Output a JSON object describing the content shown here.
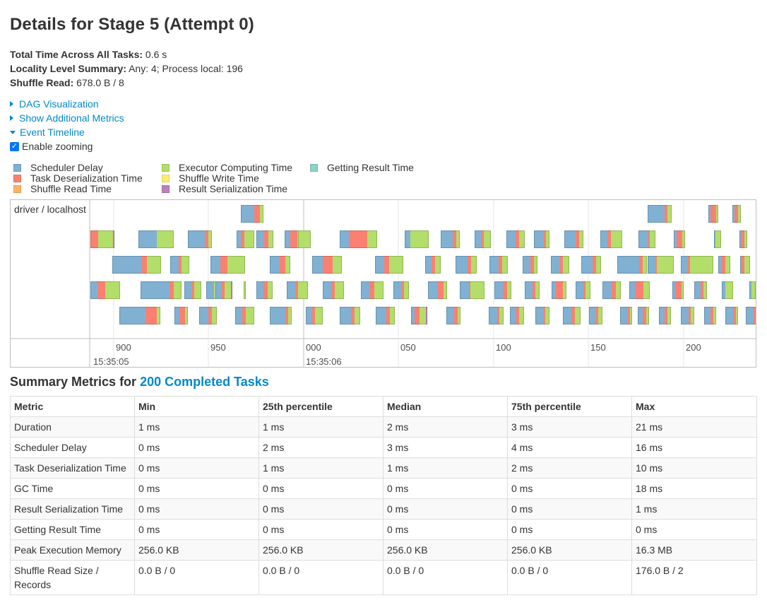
{
  "page": {
    "title": "Details for Stage 5 (Attempt 0)"
  },
  "summary": {
    "total_time_label": "Total Time Across All Tasks:",
    "total_time_value": "0.6 s",
    "locality_label": "Locality Level Summary:",
    "locality_value": "Any: 4; Process local: 196",
    "shuffle_read_label": "Shuffle Read:",
    "shuffle_read_value": "678.0 B / 8"
  },
  "expanders": {
    "dag": "DAG Visualization",
    "additional_metrics": "Show Additional Metrics",
    "event_timeline": "Event Timeline"
  },
  "zoom": {
    "label": "Enable zooming",
    "checked": true
  },
  "legend": [
    {
      "label": "Scheduler Delay",
      "color": "#80B1D3"
    },
    {
      "label": "Task Deserialization Time",
      "color": "#FB8072"
    },
    {
      "label": "Shuffle Read Time",
      "color": "#FDB462"
    },
    {
      "label": "Executor Computing Time",
      "color": "#B3DE69"
    },
    {
      "label": "Shuffle Write Time",
      "color": "#FFED6F"
    },
    {
      "label": "Result Serialization Time",
      "color": "#BC80BD"
    },
    {
      "label": "Getting Result Time",
      "color": "#8DD3C7"
    }
  ],
  "timeline": {
    "group_label": "driver / localhost",
    "axis_ticks": [
      "900",
      "950",
      "000",
      "050",
      "100",
      "150",
      "200"
    ],
    "axis_major": [
      "15:35:05",
      "15:35:06"
    ]
  },
  "metrics": {
    "title_prefix": "Summary Metrics for",
    "title_link": "200 Completed Tasks",
    "columns": [
      "Metric",
      "Min",
      "25th percentile",
      "Median",
      "75th percentile",
      "Max"
    ],
    "rows": [
      [
        "Duration",
        "1 ms",
        "1 ms",
        "2 ms",
        "3 ms",
        "21 ms"
      ],
      [
        "Scheduler Delay",
        "0 ms",
        "2 ms",
        "3 ms",
        "4 ms",
        "16 ms"
      ],
      [
        "Task Deserialization Time",
        "0 ms",
        "1 ms",
        "1 ms",
        "2 ms",
        "10 ms"
      ],
      [
        "GC Time",
        "0 ms",
        "0 ms",
        "0 ms",
        "0 ms",
        "18 ms"
      ],
      [
        "Result Serialization Time",
        "0 ms",
        "0 ms",
        "0 ms",
        "0 ms",
        "1 ms"
      ],
      [
        "Getting Result Time",
        "0 ms",
        "0 ms",
        "0 ms",
        "0 ms",
        "0 ms"
      ],
      [
        "Peak Execution Memory",
        "256.0 KB",
        "256.0 KB",
        "256.0 KB",
        "256.0 KB",
        "16.3 MB"
      ],
      [
        "Shuffle Read Size / Records",
        "0.0 B / 0",
        "0.0 B / 0",
        "0.0 B / 0",
        "0.0 B / 0",
        "176.0 B / 2"
      ]
    ]
  }
}
